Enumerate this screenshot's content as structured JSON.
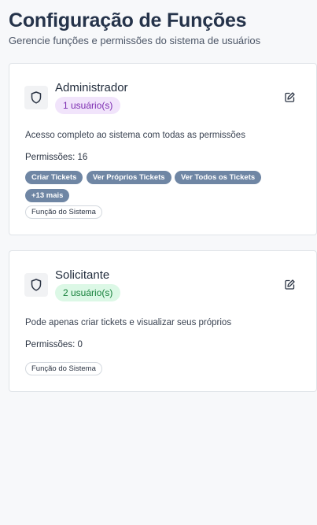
{
  "header": {
    "title": "Configuração de Funções",
    "subtitle": "Gerencie funções e permissões do sistema de usuários"
  },
  "roles": [
    {
      "name": "Administrador",
      "users_label": "1 usuário(s)",
      "badge_color": "#f1e4fb",
      "description": "Acesso completo ao sistema com todas as permissões",
      "permissions_label": "Permissões: 16",
      "permissions": [
        "Criar Tickets",
        "Ver Próprios Tickets",
        "Ver Todos os Tickets"
      ],
      "more_label": "+13 mais",
      "system_tag": "Função do Sistema"
    },
    {
      "name": "Solicitante",
      "users_label": "2 usuário(s)",
      "badge_color": "#dcf8e6",
      "description": "Pode apenas criar tickets e visualizar seus próprios",
      "permissions_label": "Permissões: 0",
      "permissions": [],
      "system_tag": "Função do Sistema"
    }
  ],
  "icons": {
    "role": "shield-icon",
    "edit": "edit-icon"
  }
}
